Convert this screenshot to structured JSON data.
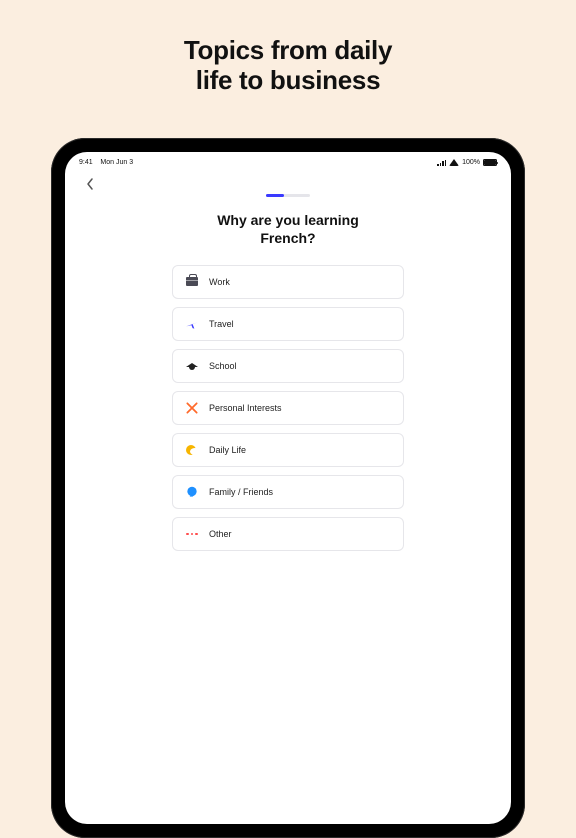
{
  "headline_line1": "Topics from daily",
  "headline_line2": "life to business",
  "statusbar": {
    "time": "9:41",
    "date": "Mon Jun 3",
    "battery_pct": "100%"
  },
  "question_line1": "Why are you learning",
  "question_line2": "French?",
  "options": [
    {
      "id": "work",
      "label": "Work",
      "icon": "briefcase-icon"
    },
    {
      "id": "travel",
      "label": "Travel",
      "icon": "airplane-icon"
    },
    {
      "id": "school",
      "label": "School",
      "icon": "graduation-cap-icon"
    },
    {
      "id": "personal",
      "label": "Personal Interests",
      "icon": "crossed-utensils-icon"
    },
    {
      "id": "daily",
      "label": "Daily Life",
      "icon": "sun-cloud-icon"
    },
    {
      "id": "family",
      "label": "Family / Friends",
      "icon": "chat-bubble-icon"
    },
    {
      "id": "other",
      "label": "Other",
      "icon": "more-dots-icon"
    }
  ]
}
